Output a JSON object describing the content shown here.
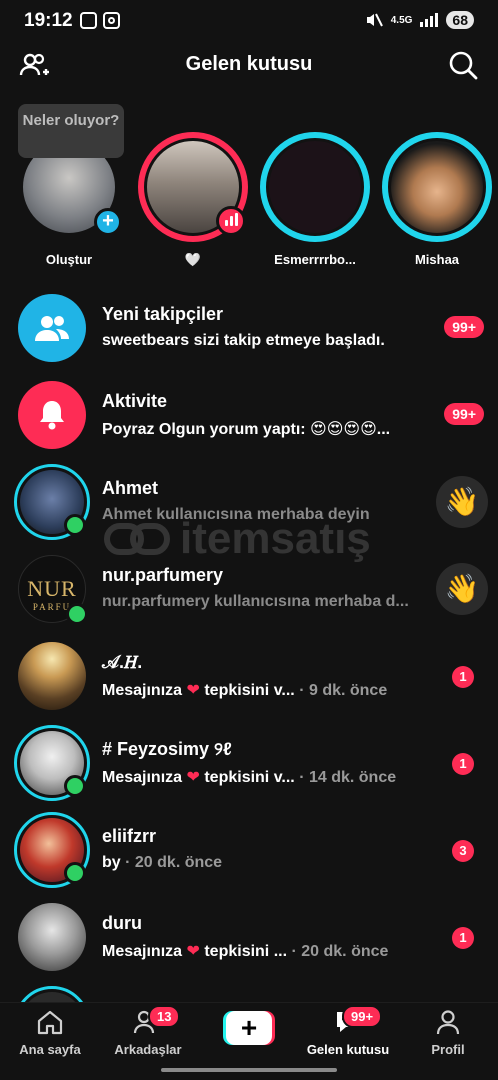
{
  "status_bar": {
    "time": "19:12",
    "network": "4.5G",
    "battery": "68"
  },
  "header": {
    "title": "Gelen kutusu"
  },
  "tooltip": {
    "text": "Neler oluyor?"
  },
  "stories": [
    {
      "name": "Oluştur",
      "ring": "none",
      "pic": "#8a8f96"
    },
    {
      "name": "🤍",
      "ring": "live",
      "pic": "#9a8e86"
    },
    {
      "name": "Esmerrrrbo...",
      "ring": "new",
      "pic": "#1c1218"
    },
    {
      "name": "Mishaa",
      "ring": "new",
      "pic": "#b5835a"
    }
  ],
  "list": [
    {
      "title": "Yeni takipçiler",
      "subtitle": "sweetbears sizi takip etmeye başladı.",
      "badge": "99+",
      "icon": "followers-icon",
      "color": "#20b4e6"
    },
    {
      "title": "Aktivite",
      "subtitle": "Poyraz Olgun yorum yaptı: 😍😍😍😍...",
      "badge": "99+",
      "icon": "bell-icon",
      "color": "#fe2c55"
    },
    {
      "title": "Ahmet",
      "subtitle": "Ahmet kullanıcısına merhaba deyin",
      "action": "👋",
      "avatar": "#2c3d5a"
    },
    {
      "title": "nur.parfumery",
      "subtitle": "nur.parfumery kullanıcısına merhaba d...",
      "action": "👋",
      "avatar": "#0f0f0f",
      "logo": "NUR",
      "logo_sub": "PARFU"
    },
    {
      "title": "𝒜.𝐻.",
      "subtitle_a": "Mesajınıza",
      "subtitle_b": "tepkisini v...",
      "ago": "· 9 dk. önce",
      "count": "1",
      "avatar": "#8a6a3a"
    },
    {
      "title": "# Feyzosimy ୨ℓ",
      "subtitle_a": "Mesajınıza",
      "subtitle_b": "tepkisini v...",
      "ago": "· 14 dk. önce",
      "count": "1",
      "avatar": "#d8d8d8"
    },
    {
      "title": "eliifzrr",
      "subtitle_a": "by",
      "ago": "· 20 dk. önce",
      "count": "3",
      "avatar": "#6a2a3a"
    },
    {
      "title": "duru",
      "subtitle_a": "Mesajınıza",
      "subtitle_b": "tepkisini ...",
      "ago": "· 20 dk. önce",
      "count": "1",
      "avatar": "#cfcfcf"
    }
  ],
  "watermark": "itemsatış",
  "nav": {
    "home": "Ana sayfa",
    "friends": "Arkadaşlar",
    "friends_badge": "13",
    "inbox": "Gelen kutusu",
    "inbox_badge": "99+",
    "profile": "Profil",
    "create": "+"
  },
  "colors": {
    "accent": "#fe2c55",
    "cyan": "#20d5ec",
    "online": "#2fd063",
    "background": "#121212"
  }
}
